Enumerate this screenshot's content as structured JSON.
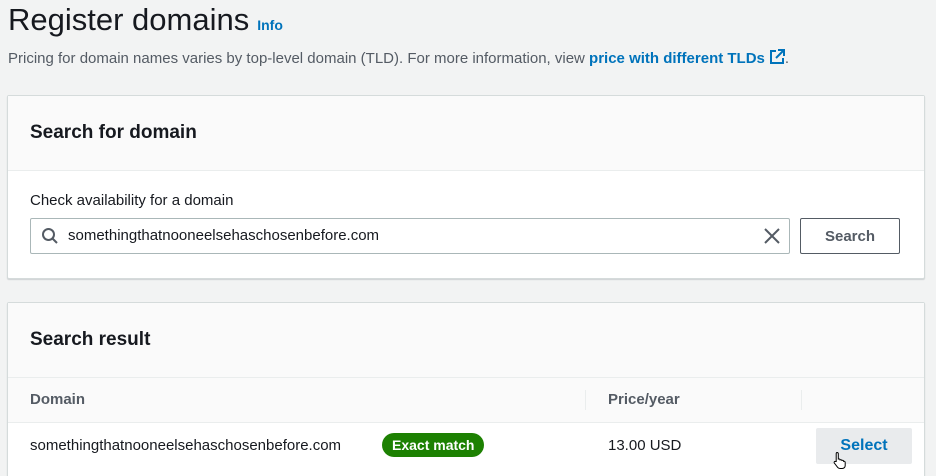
{
  "header": {
    "title": "Register domains",
    "info_label": "Info",
    "description_prefix": "Pricing for domain names varies by top-level domain (TLD). For more information, view ",
    "description_link": "price with different TLDs",
    "description_suffix": "."
  },
  "search_panel": {
    "title": "Search for domain",
    "field_label": "Check availability for a domain",
    "search_value": "somethingthatnooneelsehaschosenbefore.com",
    "search_button_label": "Search"
  },
  "result_panel": {
    "title": "Search result",
    "columns": [
      "Domain",
      "Price/year"
    ],
    "rows": [
      {
        "domain": "somethingthatnooneelsehaschosenbefore.com",
        "badge": "Exact match",
        "price": "13.00 USD",
        "action_label": "Select"
      }
    ]
  },
  "colors": {
    "link": "#0073bb",
    "badge_green": "#1d8102",
    "background": "#f2f3f3"
  },
  "icons": [
    "external-link-icon",
    "search-icon",
    "clear-icon",
    "pointer-cursor-icon"
  ]
}
